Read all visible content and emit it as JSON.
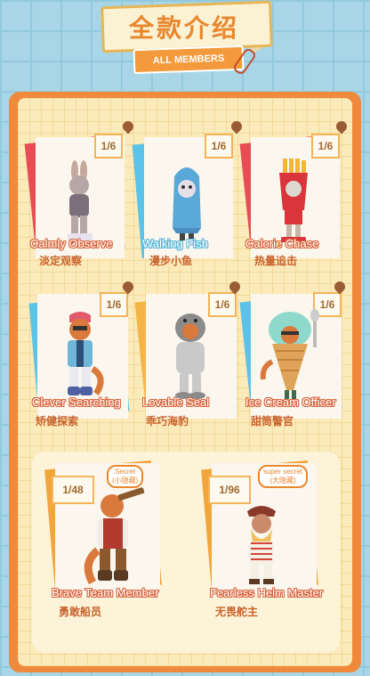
{
  "header": {
    "title": "全款介绍",
    "subtitle": "ALL MEMBERS"
  },
  "members": [
    {
      "ratio": "1/6",
      "name_en": "Calmly  Observe",
      "name_zh": "淡定观察"
    },
    {
      "ratio": "1/6",
      "name_en": "Walking Fish",
      "name_zh": "漫步小鱼"
    },
    {
      "ratio": "1/6",
      "name_en": "Calorie Chase",
      "name_zh": "热量追击"
    },
    {
      "ratio": "1/6",
      "name_en": "Clever Searching",
      "name_zh": "矫健探索"
    },
    {
      "ratio": "1/6",
      "name_en": "Lovable Seal",
      "name_zh": "乖巧海豹"
    },
    {
      "ratio": "1/6",
      "name_en": "Ice Cream Officer",
      "name_zh": "甜筒警官"
    }
  ],
  "specials": [
    {
      "ratio": "1/48",
      "badge": "Secret",
      "badge_zh": "(小隐藏)",
      "name_en": "Brave Team Member",
      "name_zh": "勇敢船员"
    },
    {
      "ratio": "1/96",
      "badge": "super secret",
      "badge_zh": "(大隐藏)",
      "name_en": "Fearless Helm Master",
      "name_zh": "无畏舵主"
    }
  ]
}
